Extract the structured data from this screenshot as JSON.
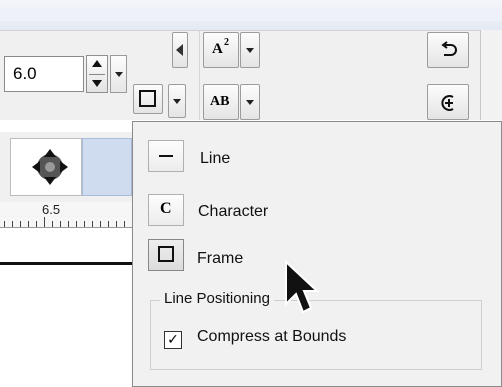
{
  "toolbar": {
    "size_value": "6.0",
    "superscript_label": "A",
    "superscript_sup": "2",
    "allcaps_label": "AB"
  },
  "ruler": {
    "label": "6.5"
  },
  "menu": {
    "items": [
      {
        "icon": "line-icon",
        "label": "Line"
      },
      {
        "icon": "character-icon",
        "label": "Character",
        "icon_text": "C"
      },
      {
        "icon": "frame-icon",
        "label": "Frame",
        "selected": true
      }
    ],
    "group": {
      "title": "Line Positioning",
      "checkbox_label": "Compress at Bounds",
      "checked": true,
      "check_glyph": "✓"
    }
  }
}
